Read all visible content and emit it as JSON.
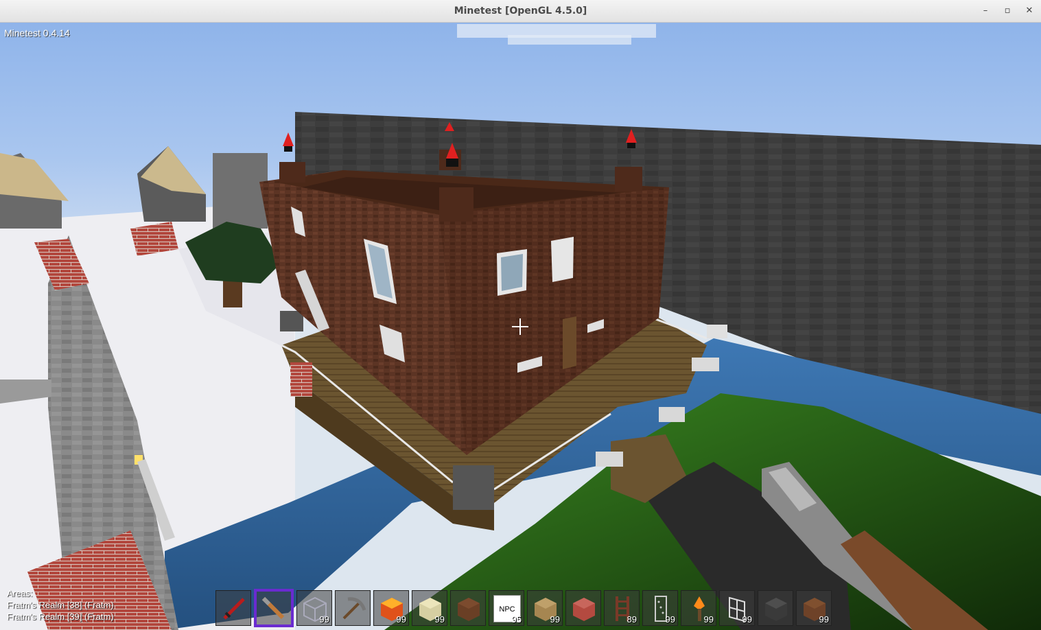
{
  "window": {
    "title": "Minetest [OpenGL 4.5.0]",
    "minimize_label": "–",
    "maximize_label": "▫",
    "close_label": "✕"
  },
  "hud": {
    "version": "Minetest 0.4.14",
    "areas_heading": "Areas:",
    "areas": [
      "Fratm's Realm [38] (Fratm)",
      "Fratm's Realm [39] (Fratm)"
    ]
  },
  "hotbar": {
    "selected_index": 1,
    "slots": [
      {
        "item": "red-sword-icon",
        "count": ""
      },
      {
        "item": "torch-stick-icon",
        "count": ""
      },
      {
        "item": "glass-block-icon",
        "count": "99"
      },
      {
        "item": "pickaxe-icon",
        "count": ""
      },
      {
        "item": "lava-block-icon",
        "count": "99"
      },
      {
        "item": "sandstone-block-icon",
        "count": "99"
      },
      {
        "item": "dirt-block-icon",
        "count": ""
      },
      {
        "item": "npc-icon",
        "label": "NPC",
        "count": "95"
      },
      {
        "item": "wood-crate-icon",
        "count": "99"
      },
      {
        "item": "brick-block-icon",
        "count": ""
      },
      {
        "item": "ladder-icon",
        "count": "89"
      },
      {
        "item": "rail-icon",
        "count": "99"
      },
      {
        "item": "flame-torch-icon",
        "count": "99"
      },
      {
        "item": "window-pane-icon",
        "count": "99"
      },
      {
        "item": "coal-block-icon",
        "count": ""
      },
      {
        "item": "dirt-block-icon",
        "count": "99"
      }
    ]
  },
  "colors": {
    "selection": "#6a2bd0",
    "brick_house": "#5a3222",
    "snow": "#f1f1f4",
    "water": "#2d5f97",
    "grass": "#3a7a20",
    "stone_wall": "#3a3a3a"
  }
}
